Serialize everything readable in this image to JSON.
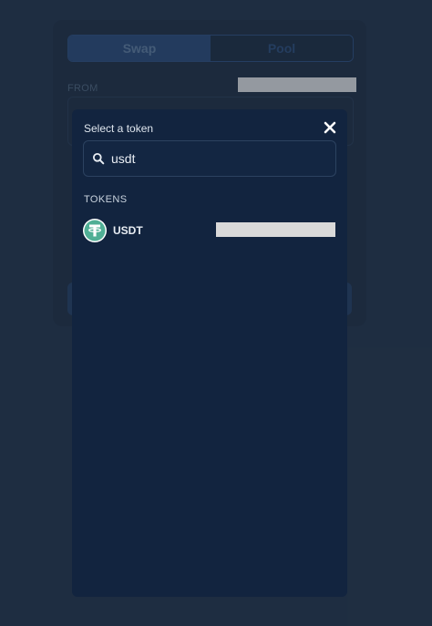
{
  "swap_panel": {
    "tabs": [
      {
        "label": "Swap"
      },
      {
        "label": "Pool"
      }
    ],
    "from_label": "FROM"
  },
  "token_modal": {
    "title": "Select a token",
    "search": {
      "value": "usdt"
    },
    "section_label": "TOKENS",
    "tokens": [
      {
        "symbol": "USDT",
        "icon": "tether-icon",
        "brand_color": "#50af95"
      }
    ]
  },
  "colors": {
    "page_bg": "#233246",
    "modal_bg": "#12243f",
    "accent": "#2a4872"
  }
}
